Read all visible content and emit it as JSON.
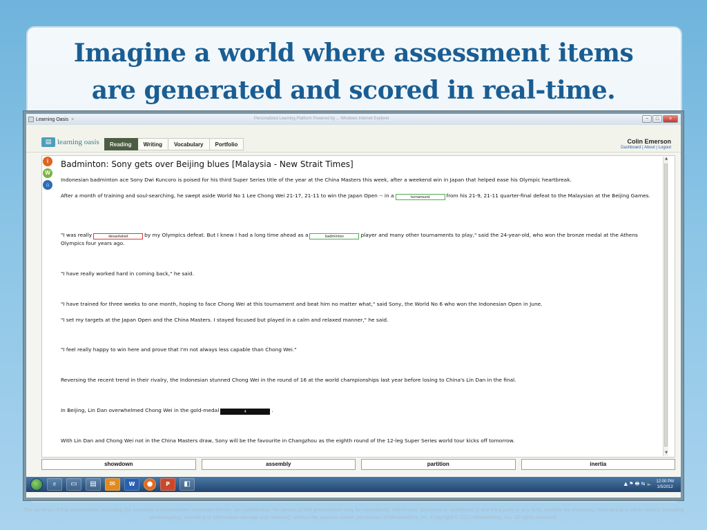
{
  "slide": {
    "title_line1": "Imagine a world where assessment items",
    "title_line2": "are generated and scored in real-time.",
    "footer": "The contents of this presentation, including the concepts and processes contained therein, are confidential. No portion of this presentation may be reproduced, referenced, disclosed or distributed to any third party in any form, whether by electronic, mechanical or other means (including photocopying, recording or information storage and retrieval), without the express written permission of MetaMetrics, Inc. Copyright © 2012 MetaMetrics, Inc. All rights reserved."
  },
  "window": {
    "tab_title": "Learning Oasis",
    "tab_close": "×",
    "faint_title": "Personalized Learning Platform Powered by ... Windows Internet Explorer",
    "controls": {
      "min": "−",
      "max": "□",
      "close": "×"
    }
  },
  "app": {
    "brand": "learning oasis",
    "nav": [
      "Reading",
      "Writing",
      "Vocabulary",
      "Portfolio"
    ],
    "user_name": "Colin Emerson",
    "user_links": "Dashboard | About | Logout"
  },
  "side_icons": {
    "info": "i",
    "w": "W",
    "home": "⌂"
  },
  "article": {
    "title": "Badminton: Sony gets over Beijing blues [Malaysia - New Strait Times]",
    "p1": "Indonesian badminton ace Sony Dwi Kuncoro is poised for his third Super Series title of the year at the China Masters this week, after a weekend win in Japan that helped ease his Olympic heartbreak.",
    "p2a": "After a month of training and soul-searching, he swept aside World No 1 Lee Chong Wei 21-17, 21-11 to win the Japan Open -- in a",
    "p2_blank": "turnaround",
    "p2b": "from his 21-9, 21-11 quarter-final defeat to the Malaysian at the Beijing Games.",
    "p3a": "\"I was really",
    "p3_blank1": "devastated",
    "p3b": "by my Olympics defeat. But I knew I had a long time ahead as a",
    "p3_blank2": "badminton",
    "p3c": "player and many other tournaments to play,\" said the 24-year-old, who won the bronze medal at the Athens Olympics four years ago.",
    "p4": "\"I have really worked hard in coming back,\" he said.",
    "p5": "\"I have trained for three weeks to one month, hoping to face Chong Wei at this tournament and beat him no matter what,\" said Sony, the World No 6 who won the Indonesian Open in June.",
    "p6": "\"I set my targets at the Japan Open and the China Masters. I stayed focused but played in a calm and relaxed manner,\" he said.",
    "p7": "\"I feel really happy to win here and prove that I'm not always less capable than Chong Wei.\"",
    "p8": "Reversing the recent trend in their rivalry, the Indonesian stunned Chong Wei in the round of 16 at the world championships last year before losing to China's Lin Dan in the final.",
    "p9a": "In Beijing, Lin Dan overwhelmed Chong Wei in the gold-medal",
    "p9_blank": "4",
    "p9b": ".",
    "p10": "With Lin Dan and Chong Wei not in the China Masters draw, Sony will be the favourite in Changzhou as the eighth round of the 12-leg Super Series world tour kicks off tomorrow."
  },
  "word_bank": [
    "showdown",
    "assembly",
    "partition",
    "inertia"
  ],
  "taskbar": {
    "ie": "e",
    "word": "W",
    "ppt": "P",
    "clock_time": "12:00 PM",
    "clock_date": "1/5/2012",
    "tray": "▲  ⚑  🖶  ⇆  🔈"
  },
  "colors": {
    "title_blue": "#1a5d92",
    "active_tab": "#4d5d44",
    "blank_green": "#4cae4c",
    "blank_red": "#d33a2f"
  }
}
